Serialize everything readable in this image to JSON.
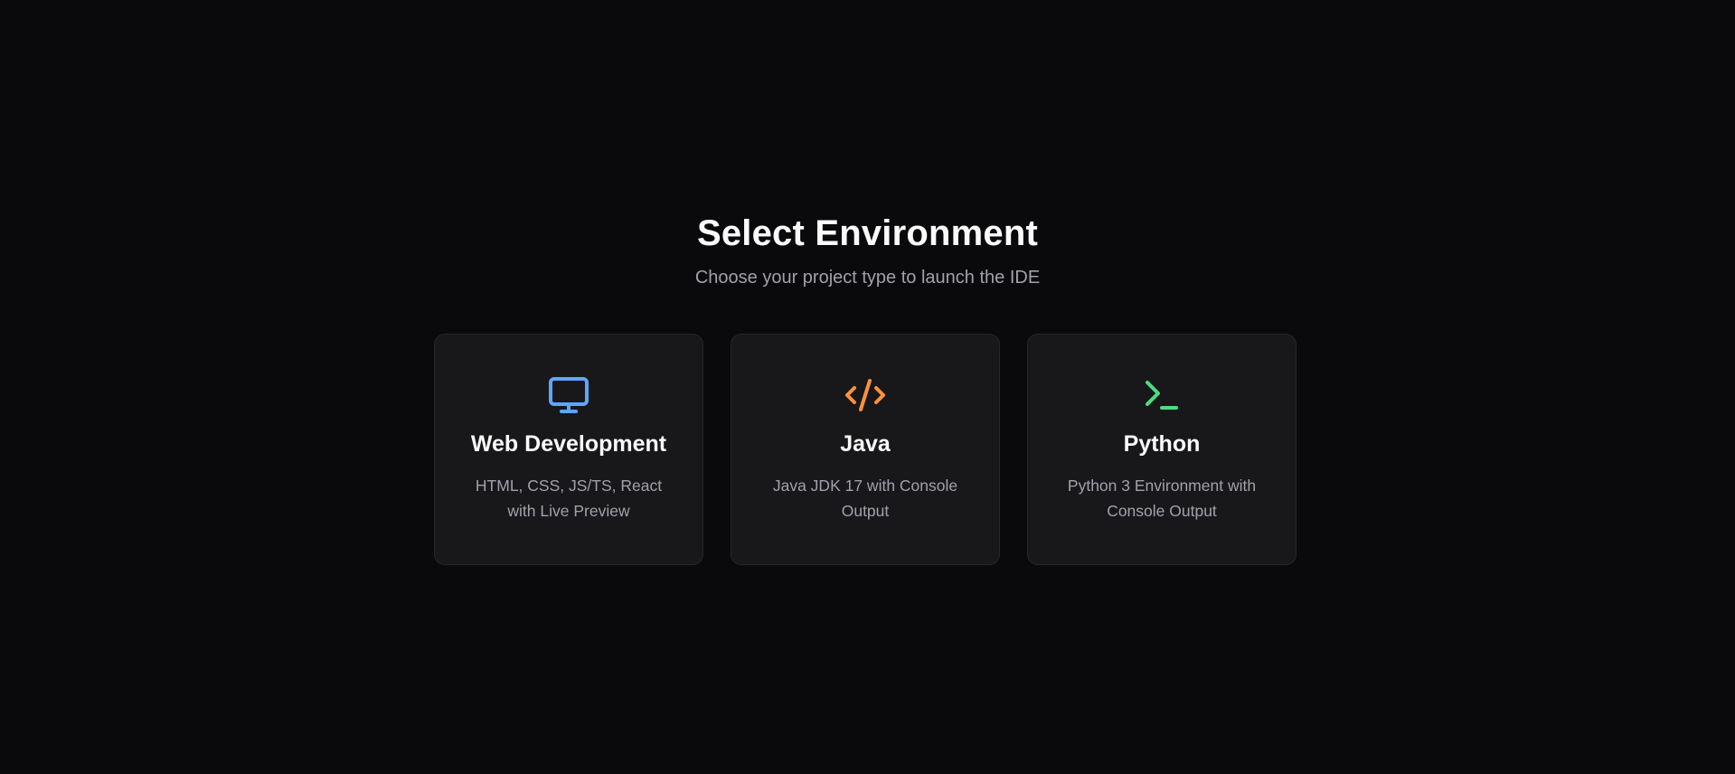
{
  "header": {
    "title": "Select Environment",
    "subtitle": "Choose your project type to launch the IDE"
  },
  "cards": [
    {
      "title": "Web Development",
      "description": "HTML, CSS, JS/TS, React with Live Preview",
      "icon": "monitor-icon",
      "icon_color": "#60a5fa"
    },
    {
      "title": "Java",
      "description": "Java JDK 17 with Console Output",
      "icon": "code-icon",
      "icon_color": "#fb923c"
    },
    {
      "title": "Python",
      "description": "Python 3 Environment with Console Output",
      "icon": "terminal-icon",
      "icon_color": "#4ade80"
    }
  ],
  "colors": {
    "background": "#0a0a0c",
    "card_background": "#18181b",
    "card_border": "#27272a"
  }
}
